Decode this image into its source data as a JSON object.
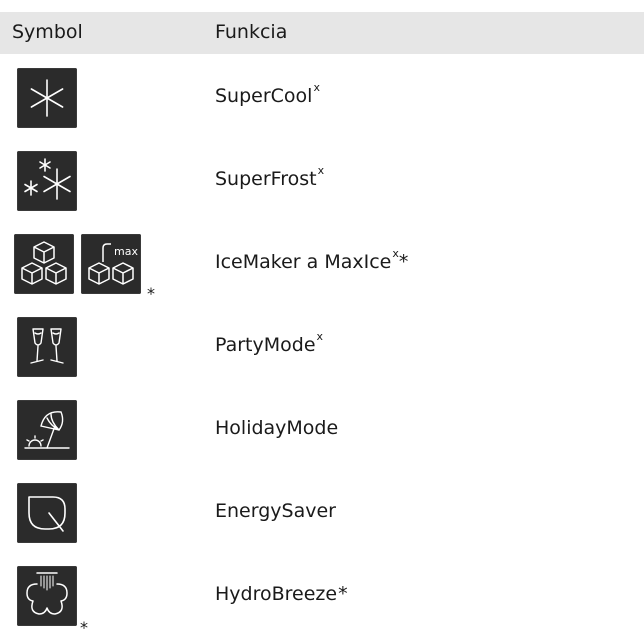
{
  "table": {
    "headers": [
      "Symbol",
      "Funkcia"
    ],
    "rows": [
      {
        "function": "SuperCool",
        "superscript": "x",
        "suffix": "",
        "icons": [
          "supercool-icon"
        ],
        "symbol_asterisk": ""
      },
      {
        "function": "SuperFrost",
        "superscript": "x",
        "suffix": "",
        "icons": [
          "superfrost-icon"
        ],
        "symbol_asterisk": ""
      },
      {
        "function": "IceMaker a MaxIce",
        "superscript": "x",
        "suffix": "*",
        "icons": [
          "icemaker-icon",
          "maxice-icon"
        ],
        "symbol_asterisk": "*",
        "icon_text": "max"
      },
      {
        "function": "PartyMode",
        "superscript": "x",
        "suffix": "",
        "icons": [
          "partymode-icon"
        ],
        "symbol_asterisk": ""
      },
      {
        "function": "HolidayMode",
        "superscript": "",
        "suffix": "",
        "icons": [
          "holidaymode-icon"
        ],
        "symbol_asterisk": ""
      },
      {
        "function": "EnergySaver",
        "superscript": "",
        "suffix": "",
        "icons": [
          "energysaver-icon"
        ],
        "symbol_asterisk": ""
      },
      {
        "function": "HydroBreeze",
        "superscript": "",
        "suffix": "*",
        "icons": [
          "hydrobreeze-icon"
        ],
        "symbol_asterisk": "*"
      }
    ]
  },
  "colors": {
    "header_bg": "#e6e6e6",
    "icon_bg": "#2b2b2b",
    "icon_fg": "#ffffff",
    "text": "#1a1a1a"
  }
}
